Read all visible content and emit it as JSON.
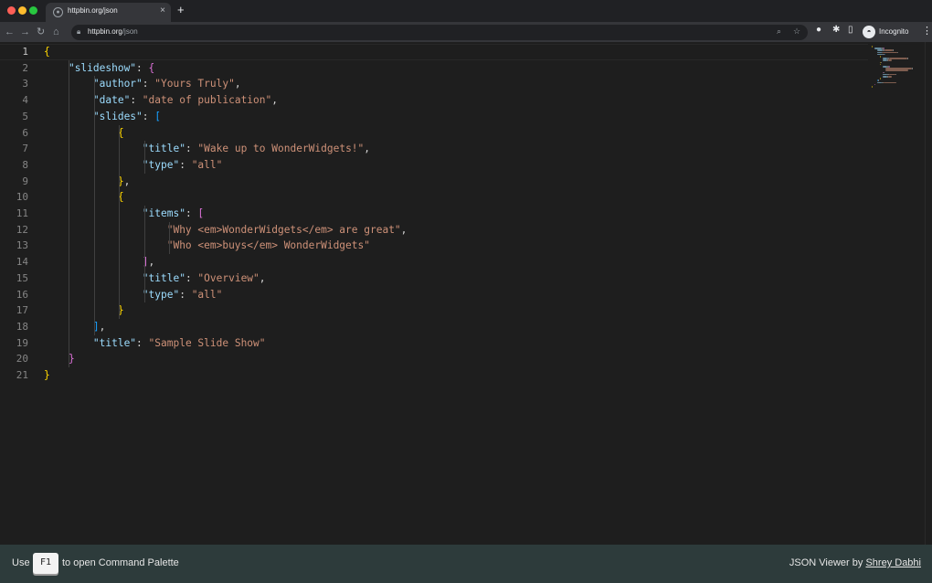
{
  "browser": {
    "tab_title": "httpbin.org/json",
    "tab_close": "×",
    "new_tab": "+",
    "url_host": "httpbin.org",
    "url_path": "/json",
    "profile_label": "Incognito",
    "icons": {
      "back": "arrow-left-icon",
      "forward": "arrow-right-icon",
      "reload": "reload-icon",
      "home": "home-icon",
      "lock": "lock-icon",
      "zoom": "zoom-icon",
      "bookmark": "star-icon",
      "extensions": "puzzle-icon",
      "sidepanel": "side-panel-icon",
      "menu": "more-vert-icon"
    }
  },
  "editor": {
    "language": "json",
    "active_line": 1,
    "line_numbers": [
      "1",
      "2",
      "3",
      "4",
      "5",
      "6",
      "7",
      "8",
      "9",
      "10",
      "11",
      "12",
      "13",
      "14",
      "15",
      "16",
      "17",
      "18",
      "19",
      "20",
      "21"
    ],
    "lines": [
      [
        {
          "t": "{",
          "c": "b1"
        }
      ],
      [
        {
          "t": "    ",
          "c": "pun"
        },
        {
          "t": "\"slideshow\"",
          "c": "key"
        },
        {
          "t": ": ",
          "c": "pun"
        },
        {
          "t": "{",
          "c": "b2"
        }
      ],
      [
        {
          "t": "        ",
          "c": "pun"
        },
        {
          "t": "\"author\"",
          "c": "key"
        },
        {
          "t": ": ",
          "c": "pun"
        },
        {
          "t": "\"Yours Truly\"",
          "c": "str"
        },
        {
          "t": ",",
          "c": "pun"
        }
      ],
      [
        {
          "t": "        ",
          "c": "pun"
        },
        {
          "t": "\"date\"",
          "c": "key"
        },
        {
          "t": ": ",
          "c": "pun"
        },
        {
          "t": "\"date of publication\"",
          "c": "str"
        },
        {
          "t": ",",
          "c": "pun"
        }
      ],
      [
        {
          "t": "        ",
          "c": "pun"
        },
        {
          "t": "\"slides\"",
          "c": "key"
        },
        {
          "t": ": ",
          "c": "pun"
        },
        {
          "t": "[",
          "c": "b3"
        }
      ],
      [
        {
          "t": "            ",
          "c": "pun"
        },
        {
          "t": "{",
          "c": "b1"
        }
      ],
      [
        {
          "t": "                ",
          "c": "pun"
        },
        {
          "t": "\"title\"",
          "c": "key"
        },
        {
          "t": ": ",
          "c": "pun"
        },
        {
          "t": "\"Wake up to WonderWidgets!\"",
          "c": "str"
        },
        {
          "t": ",",
          "c": "pun"
        }
      ],
      [
        {
          "t": "                ",
          "c": "pun"
        },
        {
          "t": "\"type\"",
          "c": "key"
        },
        {
          "t": ": ",
          "c": "pun"
        },
        {
          "t": "\"all\"",
          "c": "str"
        }
      ],
      [
        {
          "t": "            ",
          "c": "pun"
        },
        {
          "t": "}",
          "c": "b1"
        },
        {
          "t": ",",
          "c": "pun"
        }
      ],
      [
        {
          "t": "            ",
          "c": "pun"
        },
        {
          "t": "{",
          "c": "b1"
        }
      ],
      [
        {
          "t": "                ",
          "c": "pun"
        },
        {
          "t": "\"items\"",
          "c": "key"
        },
        {
          "t": ": ",
          "c": "pun"
        },
        {
          "t": "[",
          "c": "b2"
        }
      ],
      [
        {
          "t": "                    ",
          "c": "pun"
        },
        {
          "t": "\"Why <em>WonderWidgets</em> are great\"",
          "c": "str"
        },
        {
          "t": ",",
          "c": "pun"
        }
      ],
      [
        {
          "t": "                    ",
          "c": "pun"
        },
        {
          "t": "\"Who <em>buys</em> WonderWidgets\"",
          "c": "str"
        }
      ],
      [
        {
          "t": "                ",
          "c": "pun"
        },
        {
          "t": "]",
          "c": "b2"
        },
        {
          "t": ",",
          "c": "pun"
        }
      ],
      [
        {
          "t": "                ",
          "c": "pun"
        },
        {
          "t": "\"title\"",
          "c": "key"
        },
        {
          "t": ": ",
          "c": "pun"
        },
        {
          "t": "\"Overview\"",
          "c": "str"
        },
        {
          "t": ",",
          "c": "pun"
        }
      ],
      [
        {
          "t": "                ",
          "c": "pun"
        },
        {
          "t": "\"type\"",
          "c": "key"
        },
        {
          "t": ": ",
          "c": "pun"
        },
        {
          "t": "\"all\"",
          "c": "str"
        }
      ],
      [
        {
          "t": "            ",
          "c": "pun"
        },
        {
          "t": "}",
          "c": "b1"
        }
      ],
      [
        {
          "t": "        ",
          "c": "pun"
        },
        {
          "t": "]",
          "c": "b3"
        },
        {
          "t": ",",
          "c": "pun"
        }
      ],
      [
        {
          "t": "        ",
          "c": "pun"
        },
        {
          "t": "\"title\"",
          "c": "key"
        },
        {
          "t": ": ",
          "c": "pun"
        },
        {
          "t": "\"Sample Slide Show\"",
          "c": "str"
        }
      ],
      [
        {
          "t": "    ",
          "c": "pun"
        },
        {
          "t": "}",
          "c": "b2"
        }
      ],
      [
        {
          "t": "}",
          "c": "b1"
        }
      ]
    ]
  },
  "statusbar": {
    "hint_prefix": "Use",
    "hint_key": "F1",
    "hint_suffix": "to open Command Palette",
    "credit_prefix": "JSON Viewer by ",
    "credit_author": "Shrey Dabhi"
  }
}
